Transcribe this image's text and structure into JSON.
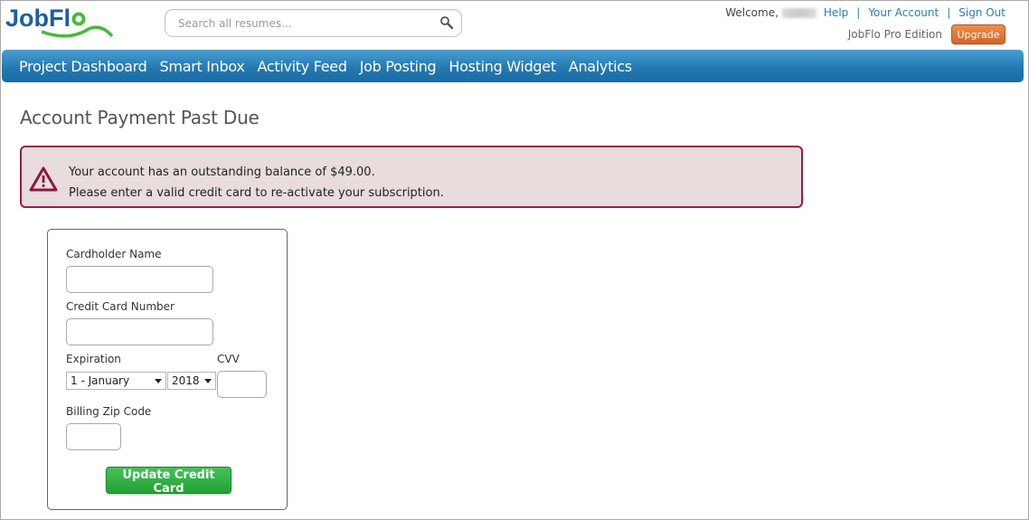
{
  "header": {
    "logo_text": "JobFlo",
    "search": {
      "placeholder": "Search all resumes...",
      "value": ""
    },
    "welcome_label": "Welcome,",
    "links": {
      "help": "Help",
      "account": "Your Account",
      "sign_out": "Sign Out"
    },
    "edition": "JobFlo Pro Edition",
    "upgrade_label": "Upgrade"
  },
  "nav": {
    "items": [
      "Project Dashboard",
      "Smart Inbox",
      "Activity Feed",
      "Job Posting",
      "Hosting Widget",
      "Analytics"
    ]
  },
  "page": {
    "title": "Account Payment Past Due",
    "alert": {
      "line1": "Your account has an outstanding balance of $49.00.",
      "line2": "Please enter a valid credit card to re-activate your subscription."
    }
  },
  "form": {
    "cardholder_label": "Cardholder Name",
    "card_number_label": "Credit Card Number",
    "expiration_label": "Expiration",
    "month_value": "1 - January",
    "year_value": "2018",
    "cvv_label": "CVV",
    "zip_label": "Billing Zip Code",
    "submit_label": "Update Credit Card"
  },
  "colors": {
    "nav_blue": "#2479b2",
    "link_blue": "#2b7bb9",
    "alert_border": "#9a1a4a",
    "alert_bg": "#e8dcdc",
    "upgrade_orange": "#d3662a",
    "submit_green": "#22a036"
  }
}
